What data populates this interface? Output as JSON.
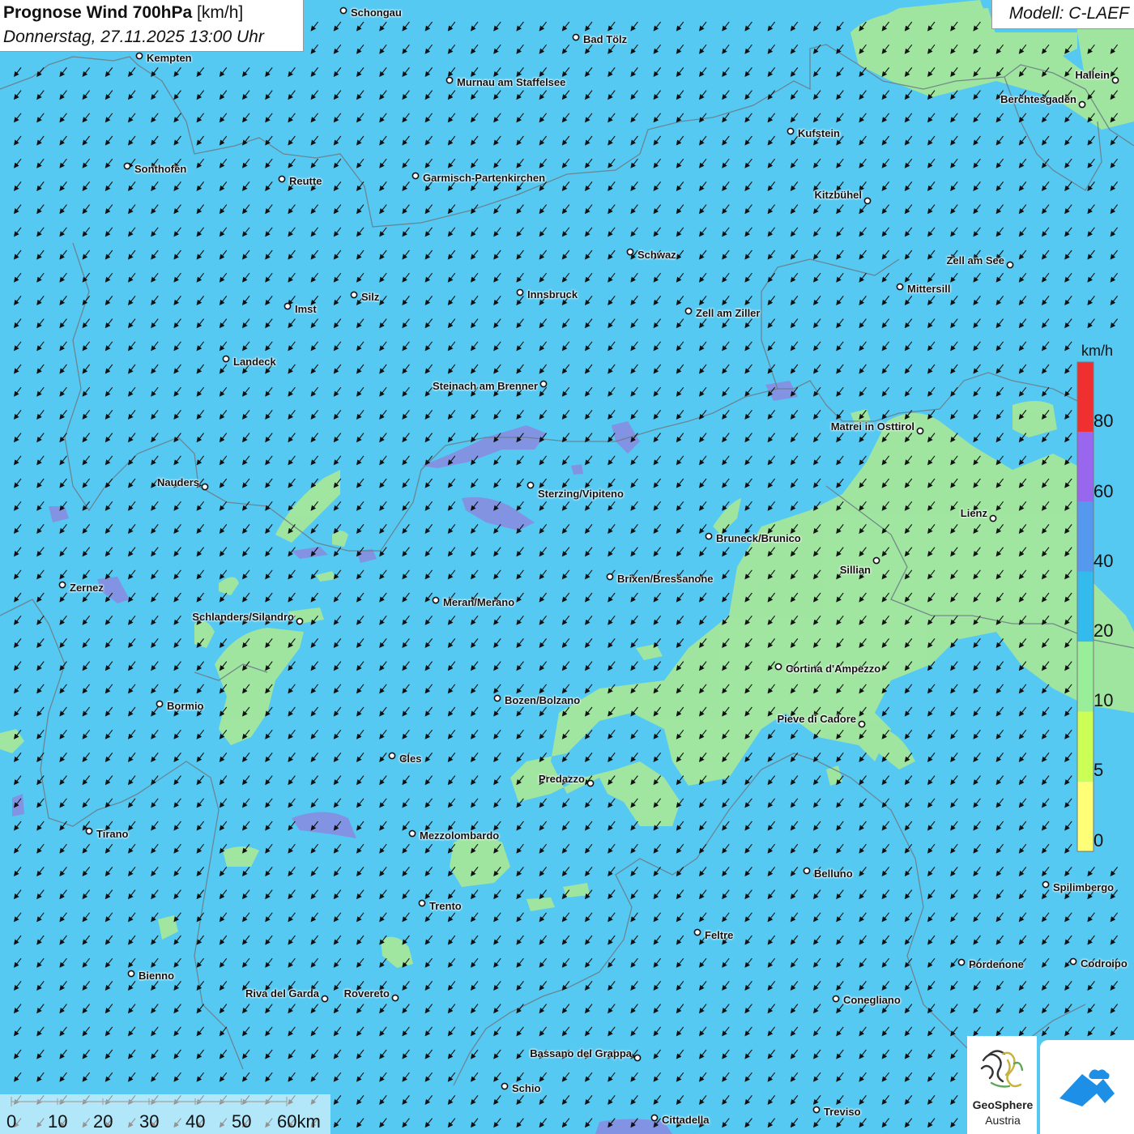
{
  "header": {
    "title_bold": "Prognose Wind 700hPa",
    "title_unit": "[km/h]",
    "datetime": "Donnerstag, 27.11.2025 13:00 Uhr",
    "model": "Modell: C-LAEF"
  },
  "legend": {
    "unit": "km/h",
    "labels": [
      "80",
      "60",
      "40",
      "20",
      "10",
      "5",
      "0"
    ],
    "colors": [
      "#f03030",
      "#9966ee",
      "#5599ee",
      "#33bbee",
      "#99ee99",
      "#ccff55",
      "#ffff77"
    ]
  },
  "scale_bar": {
    "labels": [
      "0",
      "10",
      "20",
      "30",
      "40",
      "50",
      "60km"
    ]
  },
  "branding": {
    "org_name": "GeoSphere",
    "org_country": "Austria"
  },
  "map_colors": {
    "background": "#56c9f2",
    "calm_zone": "#a4e79b",
    "strong_zone": "#8e86df"
  },
  "wind": {
    "direction": "from north-east",
    "arrow_icon": "arrow-southwest-icon"
  },
  "cities": [
    {
      "name": "Schongau"
    },
    {
      "name": "Bad Tölz"
    },
    {
      "name": "Kempten"
    },
    {
      "name": "Murnau am Staffelsee"
    },
    {
      "name": "Hallein"
    },
    {
      "name": "Berchtesgaden"
    },
    {
      "name": "Kufstein"
    },
    {
      "name": "Sonthofen"
    },
    {
      "name": "Reutte"
    },
    {
      "name": "Garmisch-Partenkirchen"
    },
    {
      "name": "Kitzbühel"
    },
    {
      "name": "Schwaz"
    },
    {
      "name": "Zell am See"
    },
    {
      "name": "Mittersill"
    },
    {
      "name": "Imst"
    },
    {
      "name": "Silz"
    },
    {
      "name": "Innsbruck"
    },
    {
      "name": "Zell am Ziller"
    },
    {
      "name": "Landeck"
    },
    {
      "name": "Steinach am Brenner"
    },
    {
      "name": "Matrei in Osttirol"
    },
    {
      "name": "Nauders"
    },
    {
      "name": "Sterzing/Vipiteno"
    },
    {
      "name": "Lienz"
    },
    {
      "name": "Bruneck/Brunico"
    },
    {
      "name": "Sillian"
    },
    {
      "name": "Zernez"
    },
    {
      "name": "Brixen/Bressanone"
    },
    {
      "name": "Meran/Merano"
    },
    {
      "name": "Schlanders/Silandro"
    },
    {
      "name": "Cortina d'Ampezzo"
    },
    {
      "name": "Bozen/Bolzano"
    },
    {
      "name": "Bormio"
    },
    {
      "name": "Pieve di Cadore"
    },
    {
      "name": "Cles"
    },
    {
      "name": "Predazzo"
    },
    {
      "name": "Tirano"
    },
    {
      "name": "Mezzolombardo"
    },
    {
      "name": "Belluno"
    },
    {
      "name": "Spilimbergo"
    },
    {
      "name": "Trento"
    },
    {
      "name": "Feltre"
    },
    {
      "name": "Pordenone"
    },
    {
      "name": "Codroipo"
    },
    {
      "name": "Bienno"
    },
    {
      "name": "Riva del Garda"
    },
    {
      "name": "Rovereto"
    },
    {
      "name": "Conegliano"
    },
    {
      "name": "Bassano del Grappa"
    },
    {
      "name": "Schio"
    },
    {
      "name": "Treviso"
    },
    {
      "name": "Cittadella"
    }
  ]
}
